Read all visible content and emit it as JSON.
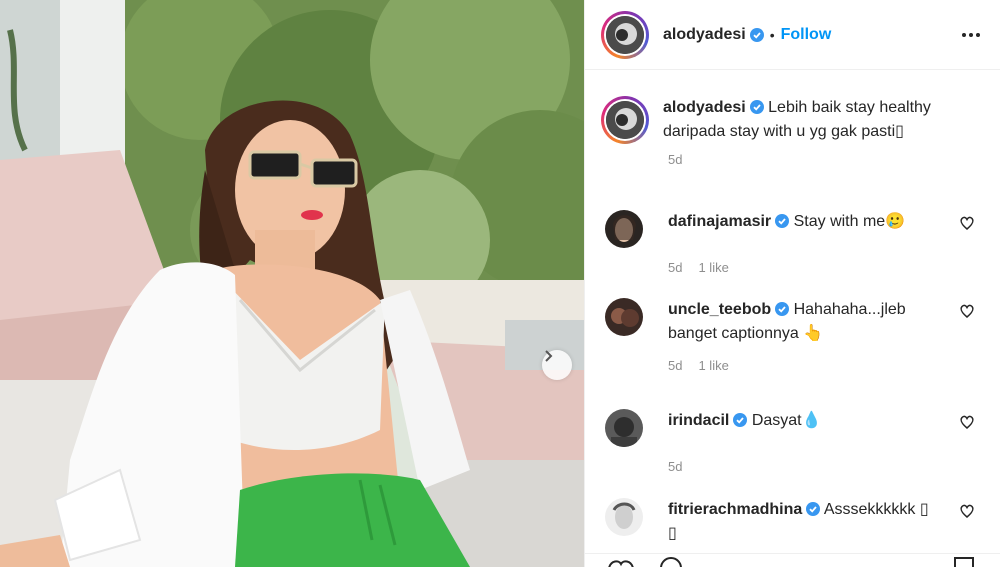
{
  "post": {
    "author": "alodyadesi",
    "follow_label": "Follow",
    "separator": "•"
  },
  "caption": {
    "username": "alodyadesi",
    "text": "Lebih baik stay healthy daripada stay with u yg gak pasti▯",
    "age": "5d"
  },
  "comments": [
    {
      "username": "dafinajamasir",
      "text": "Stay with me🥲",
      "age": "5d",
      "likes": "1 like"
    },
    {
      "username": "uncle_teebob",
      "text": "Hahahaha...jleb banget captionnya 👆",
      "age": "5d",
      "likes": "1 like"
    },
    {
      "username": "irindacil",
      "text": "Dasyat💧",
      "age": "5d",
      "likes": ""
    },
    {
      "username": "fitrierachmadhina",
      "text": "Asssekkkkkk ▯ ▯",
      "age": "",
      "likes": ""
    }
  ],
  "colors": {
    "accent": "#0095f6",
    "verified": "#3897f0",
    "muted": "#8e8e8e",
    "text": "#262626"
  },
  "icons": {
    "next": "chevron-right-icon",
    "heart": "heart-outline-icon",
    "more": "more-horizontal-icon",
    "verified": "verified-badge-icon"
  }
}
